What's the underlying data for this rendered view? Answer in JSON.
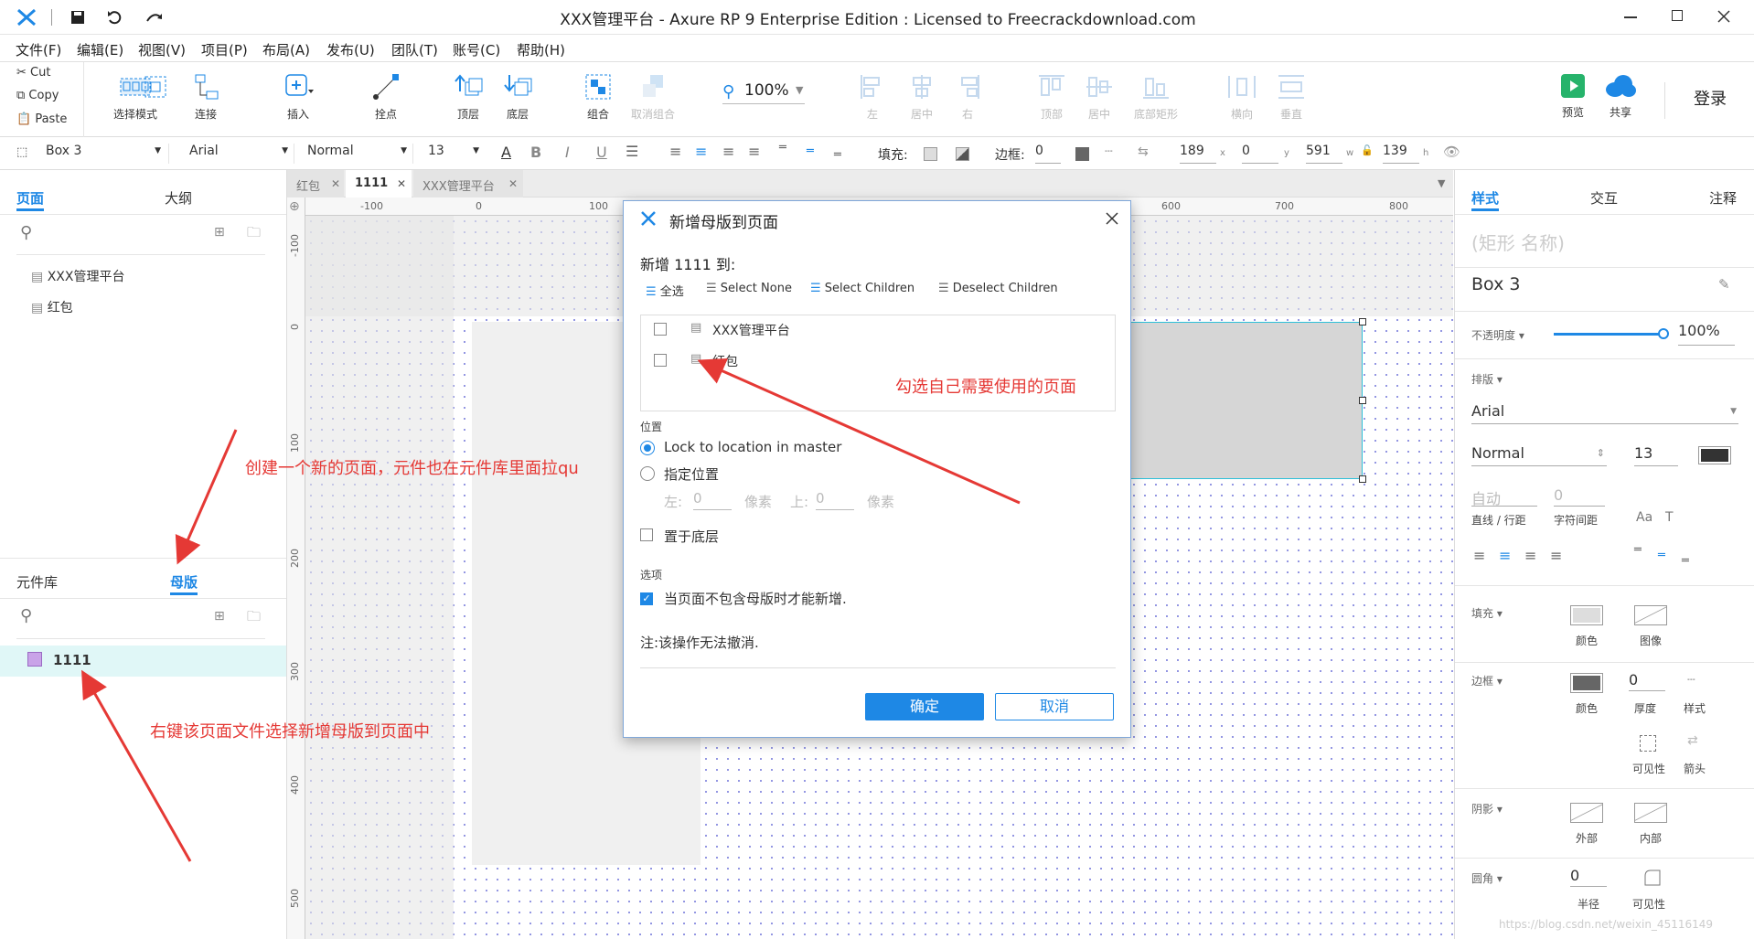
{
  "window": {
    "title": "XXX管理平台 - Axure RP 9 Enterprise Edition : Licensed to Freecrackdownload.com"
  },
  "menu": [
    "文件(F)",
    "编辑(E)",
    "视图(V)",
    "项目(P)",
    "布局(A)",
    "发布(U)",
    "团队(T)",
    "账号(C)",
    "帮助(H)"
  ],
  "clipboard": {
    "cut": "Cut",
    "copy": "Copy",
    "paste": "Paste"
  },
  "toolbar": {
    "select_mode": "选择模式",
    "connect": "连接",
    "insert": "插入",
    "anchor": "拴点",
    "top": "顶层",
    "bottom": "底层",
    "group": "组合",
    "ungroup": "取消组合",
    "zoom": "100%",
    "left": "左",
    "center": "居中",
    "right": "右",
    "top_align": "顶部",
    "middle": "居中",
    "bottom_align": "底部矩形",
    "horizontal": "横向",
    "vertical": "垂直",
    "preview": "预览",
    "share": "共享",
    "login": "登录"
  },
  "format": {
    "widget_name": "Box 3",
    "font": "Arial",
    "style": "Normal",
    "size": "13",
    "fill_label": "填充:",
    "border_label": "边框:",
    "border_value": "0",
    "x": "189",
    "x_lbl": "x",
    "y": "0",
    "y_lbl": "y",
    "w": "591",
    "w_lbl": "w",
    "h": "139",
    "h_lbl": "h"
  },
  "left_panel": {
    "tab_pages": "页面",
    "tab_outline": "大纲",
    "pages": [
      "XXX管理平台",
      "红包"
    ],
    "tab_library": "元件库",
    "tab_masters": "母版",
    "masters": [
      "1111"
    ]
  },
  "doc_tabs": [
    "红包",
    "1111",
    "XXX管理平台"
  ],
  "ruler": {
    "h": [
      "-100",
      "0",
      "100",
      "600",
      "700",
      "800"
    ],
    "v": [
      "-100",
      "0",
      "100",
      "200",
      "300",
      "400",
      "500"
    ]
  },
  "dialog": {
    "title": "新增母版到页面",
    "heading": "新增 1111 到:",
    "select_all": "全选",
    "select_none": "Select None",
    "select_children": "Select Children",
    "deselect_children": "Deselect Children",
    "pages": [
      "XXX管理平台",
      "红包"
    ],
    "position_label": "位置",
    "lock_option": "Lock to location in master",
    "specify_option": "指定位置",
    "left_label": "左:",
    "left_value": "0",
    "px1": "像素",
    "top_label": "上:",
    "top_value": "0",
    "px2": "像素",
    "send_back": "置于底层",
    "options_label": "选项",
    "only_if_missing": "当页面不包含母版时才能新增.",
    "note": "注:该操作无法撤消.",
    "ok": "确定",
    "cancel": "取消"
  },
  "annotations": {
    "a1": "勾选自己需要使用的页面",
    "a2": "创建一个新的页面，元件也在元件库里面拉qu",
    "a3": "右键该页面文件选择新增母版到页面中"
  },
  "right_panel": {
    "tab_style": "样式",
    "tab_interact": "交互",
    "tab_notes": "注释",
    "shape_name_placeholder": "(矩形 名称)",
    "widget_name": "Box 3",
    "opacity_label": "不透明度 ▾",
    "opacity_value": "100%",
    "opacity_level": 1.0,
    "typography_label": "排版 ▾",
    "font": "Arial",
    "font_style": "Normal",
    "font_size": "13",
    "line_spacing_value": "自动",
    "line_spacing_label": "直线 / 行距",
    "char_spacing_value": "0",
    "char_spacing_label": "字符间距",
    "fill_label": "填充 ▾",
    "fill_color": "颜色",
    "fill_image": "图像",
    "border_label": "边框 ▾",
    "border_color": "颜色",
    "border_thickness_value": "0",
    "border_thickness": "厚度",
    "border_style": "样式",
    "visibility": "可见性",
    "arrows": "箭头",
    "shadow_label": "阴影 ▾",
    "shadow_outer": "外部",
    "shadow_inner": "内部",
    "radius_label": "圆角 ▾",
    "radius_value": "0",
    "radius": "半径",
    "radius_visibility": "可见性"
  },
  "watermark": "https://blog.csdn.net/weixin_45116149",
  "colors": {
    "accent": "#1e88e5",
    "annotation": "#e53935",
    "master_bg": "#e0f7f7"
  }
}
